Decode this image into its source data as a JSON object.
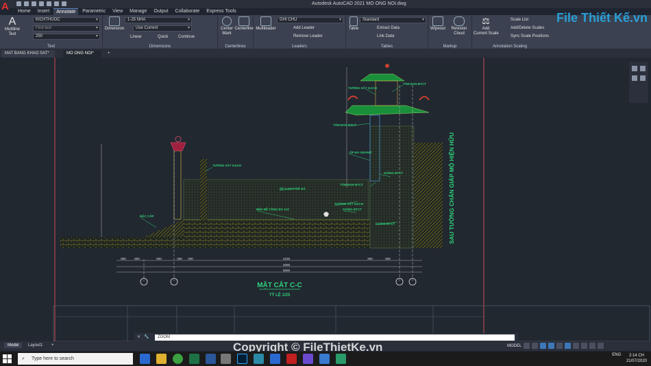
{
  "window": {
    "title": "Autodesk AutoCAD 2021    MO ONG NOI.dwg",
    "app_letter": "A"
  },
  "menu": [
    "Home",
    "Insert",
    "Annotate",
    "Parametric",
    "View",
    "Manage",
    "Output",
    "Collaborate",
    "Express Tools"
  ],
  "active_menu": "Annotate",
  "ribbon": {
    "text_panel": {
      "label": "Text",
      "multiline": "Multiline\nText",
      "style": "KICHTHUOC",
      "find": "Find text",
      "height": "250"
    },
    "dimensions_panel": {
      "label": "Dimensions",
      "dimension": "Dimension",
      "style": "1-25 NHA",
      "layer": "Use Current",
      "linear": "Linear",
      "quick": "Quick",
      "continue": "Continue"
    },
    "centerlines_panel": {
      "label": "Centerlines",
      "center_mark": "Center\nMark",
      "centerline": "Centerline"
    },
    "leaders_panel": {
      "label": "Leaders",
      "multileader": "Multileader",
      "style": "GHI CHU",
      "add": "Add Leader",
      "remove": "Remove Leader"
    },
    "tables_panel": {
      "label": "Tables",
      "table": "Table",
      "style": "Standard",
      "extract": "Extract Data",
      "link": "Link Data"
    },
    "markup_panel": {
      "label": "Markup",
      "wipeout": "Wipeout",
      "revision": "Revision\nCloud"
    },
    "scaling_panel": {
      "label": "Annotation Scaling",
      "add_scale": "Add\nCurrent Scale",
      "scale_list": "Scale List",
      "add_delete": "Add/Delete Scales",
      "sync": "Sync Scale Positions"
    }
  },
  "file_tabs": [
    "MAT BANG KHAO SAT*",
    "MO ONG NOI*"
  ],
  "active_file_tab": "MO ONG NOI*",
  "drawing": {
    "title": "MẶT CẮT C-C",
    "scale": "TỶ LỆ 1/25",
    "side_label": "SAU TƯỜNG CHẮN GIÁP MỘ HIỆN HỮU",
    "annotations": [
      "TƯỜNG XÂY GẠCH",
      "TẤM ĐAN BTCT",
      "TẤM ĐAN BTCT",
      "ỐP ĐÁ GRANIT",
      "TƯỜNG XÂY GẠCH",
      "ỐP GẠCH GIẢ ĐÁ",
      "TẤM ĐAN BTCT",
      "GIẰNG BTCT",
      "TƯỜNG XÂY GẠCH",
      "GIẰNG BTCT",
      "BÊN BỂ TÔNG ĐÁ 1x2",
      "BẬC CẤP",
      "GIẰNG BTCT"
    ],
    "dims_bottom": [
      "800",
      "800",
      "600",
      "200",
      "200",
      "4100",
      "200",
      "600"
    ],
    "dims_total": [
      "4000",
      "6000"
    ]
  },
  "command": {
    "prompt": "ZOOM"
  },
  "layout_tabs": [
    "Model",
    "Layout1"
  ],
  "active_layout": "Model",
  "status": {
    "mode": "MODEL"
  },
  "taskbar": {
    "search_placeholder": "Type here to search",
    "lang": "ENG",
    "time": "2:14 CH",
    "date": "21/07/2020"
  },
  "watermarks": {
    "bottom": "Copyright © FileThietKe.vn",
    "logo": "File Thiết Kế.vn"
  },
  "colors": {
    "accent": "#3c78b8",
    "canvas": "#212830",
    "frame": "#d04a5a",
    "hatch": "#c8a020",
    "green": "#2fd27a",
    "roof": "#1a8f3a"
  }
}
